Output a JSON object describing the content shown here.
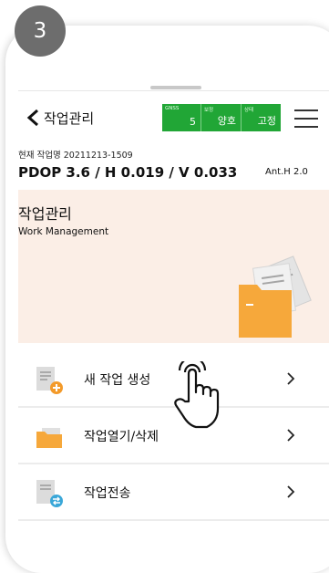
{
  "step_badge": "3",
  "header": {
    "title": "작업관리",
    "status": {
      "gnss_label": "GNSS",
      "gnss_value": "5",
      "correction_label": "보정",
      "correction_value": "양호",
      "state_label": "상태",
      "state_value": "고정"
    }
  },
  "job": {
    "label": "현재 작업명 20211213-1509",
    "dop": "PDOP 3.6 / H 0.019 / V 0.033",
    "antenna": "Ant.H  2.0"
  },
  "section": {
    "title": "작업관리",
    "subtitle": "Work Management"
  },
  "menu": [
    {
      "label": "새 작업 생성",
      "icon": "new-document-icon"
    },
    {
      "label": "작업열기/삭제",
      "icon": "folder-icon"
    },
    {
      "label": "작업전송",
      "icon": "transfer-document-icon"
    }
  ],
  "colors": {
    "status_green": "#21a636",
    "section_bg": "#fbeee6",
    "folder_orange": "#f6a83b",
    "badge_gray": "#6d6d6d"
  }
}
